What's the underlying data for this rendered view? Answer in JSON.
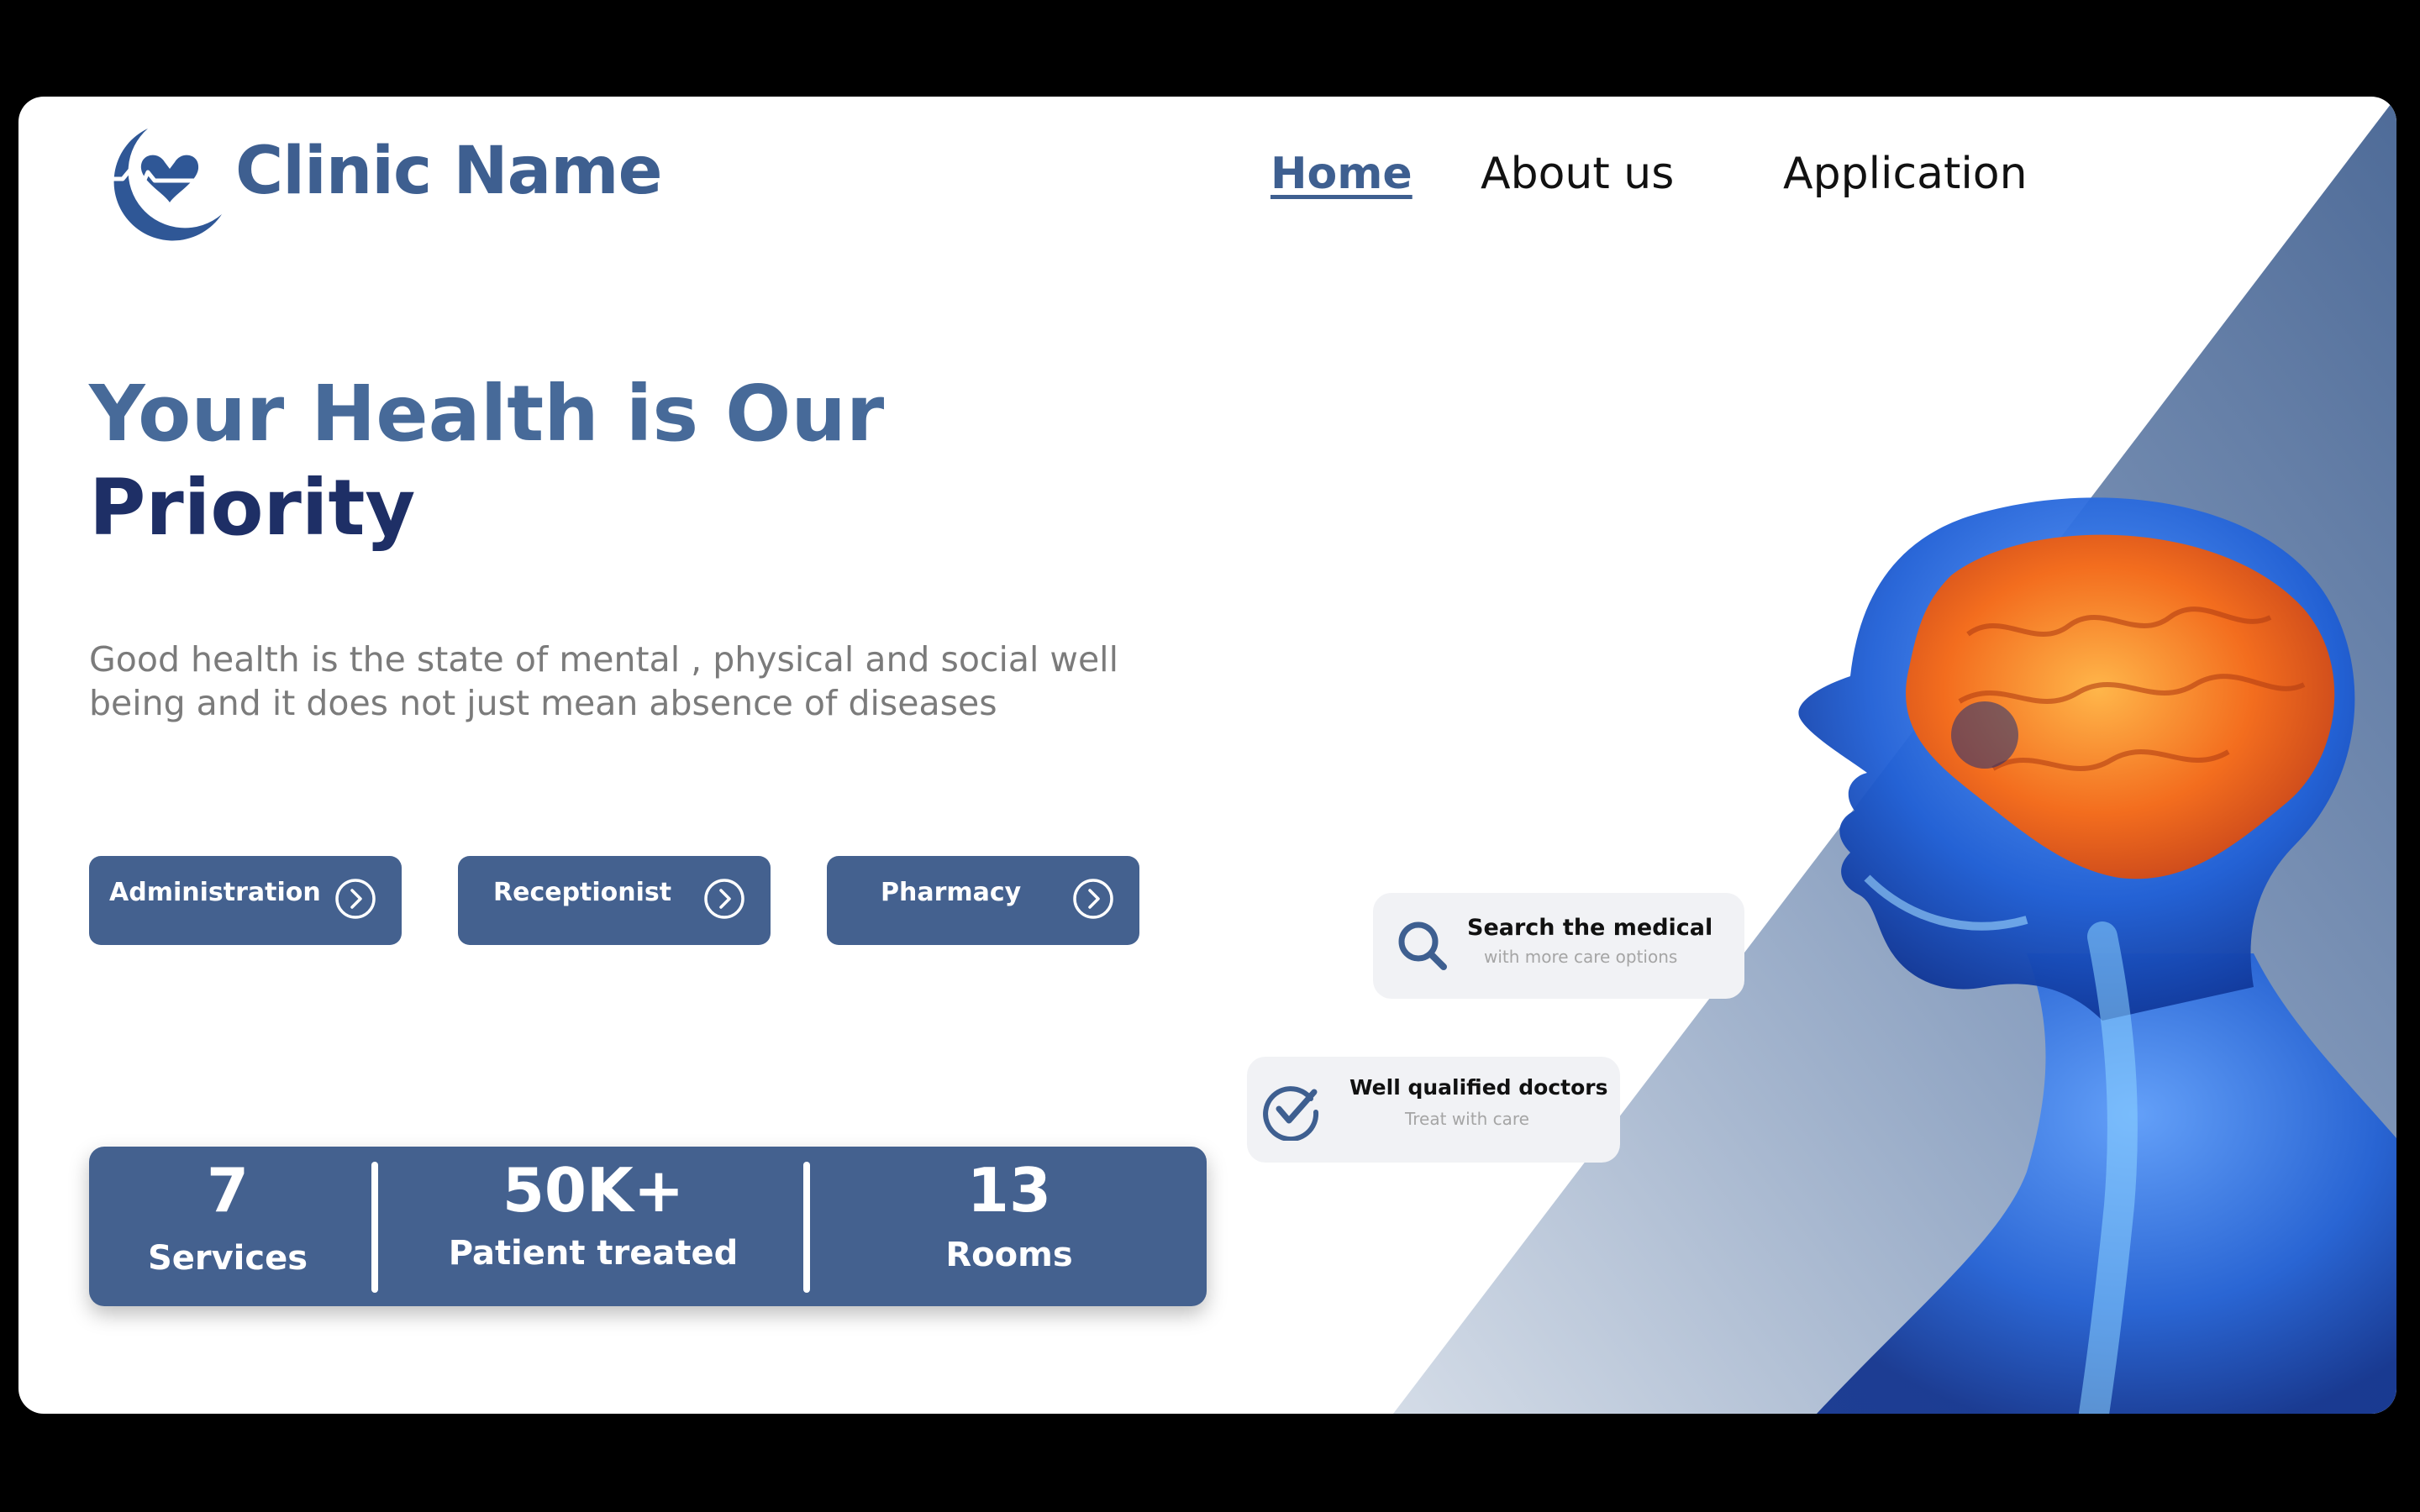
{
  "brand": {
    "name": "Clinic Name",
    "logo_icon": "moon-heartbeat-logo-icon"
  },
  "nav": {
    "items": [
      "Home",
      "About us",
      "Application"
    ],
    "active": "Home"
  },
  "hero": {
    "title_line1": "Your Health is Our",
    "title_line2": "Priority",
    "description": "Good health is the state of mental , physical and social well being and it does not just mean absence of diseases"
  },
  "buttons": [
    {
      "label": "Administration",
      "icon": "chevron-right-circle-icon"
    },
    {
      "label": "Receptionist",
      "icon": "chevron-right-circle-icon"
    },
    {
      "label": "Pharmacy",
      "icon": "chevron-right-circle-icon"
    }
  ],
  "stats": [
    {
      "value": "7",
      "caption": "Services"
    },
    {
      "value": "50K+",
      "caption": "Patient treated"
    },
    {
      "value": "13",
      "caption": "Rooms"
    }
  ],
  "features": {
    "search": {
      "title": "Search the medical",
      "subtitle": "with more care options",
      "icon": "search-icon"
    },
    "doctors": {
      "title": "Well qualified doctors",
      "subtitle": "Treat with care",
      "icon": "check-circle-icon"
    }
  },
  "colors": {
    "primary": "#44618f",
    "brand_text": "#3e5f90",
    "hero_dark": "#1e2f66",
    "muted": "#7b7b7b"
  }
}
